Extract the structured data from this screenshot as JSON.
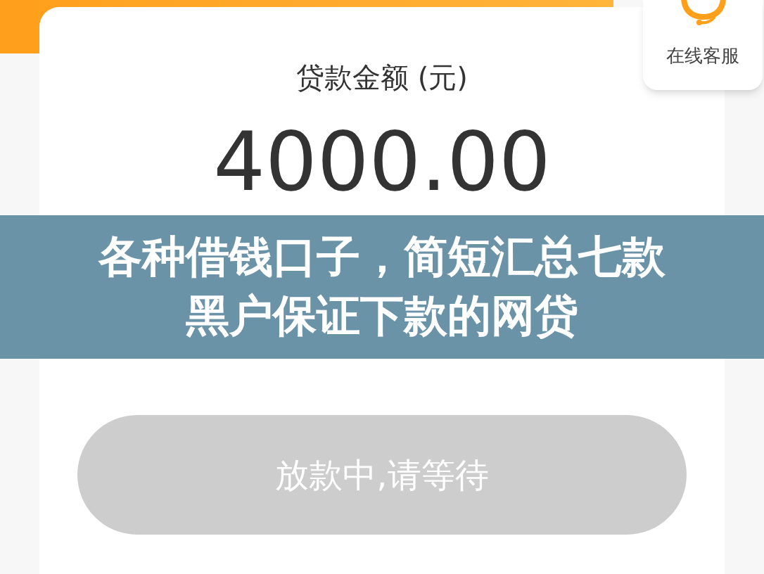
{
  "loan_card": {
    "amount_label": "贷款金额 (元)",
    "amount": "4000.00"
  },
  "customer_service": {
    "label": "在线客服"
  },
  "banner": {
    "lines": [
      "各种借钱口子，简短汇总七款",
      "黑户保证下款的网贷"
    ]
  },
  "status_button": {
    "label": "放款中,请等待",
    "disabled": true
  }
}
